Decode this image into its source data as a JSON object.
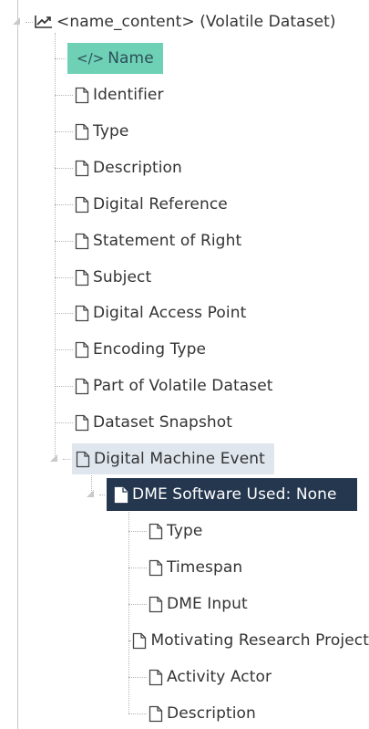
{
  "root": {
    "label": "<name_content> (Volatile Dataset)",
    "icon": "line-chart-icon"
  },
  "children": [
    {
      "label": "Name",
      "icon": "code-icon",
      "state": "highlighted"
    },
    {
      "label": "Identifier",
      "icon": "document-icon"
    },
    {
      "label": "Type",
      "icon": "document-icon"
    },
    {
      "label": "Description",
      "icon": "document-icon"
    },
    {
      "label": "Digital Reference",
      "icon": "document-icon"
    },
    {
      "label": "Statement of Right",
      "icon": "document-icon"
    },
    {
      "label": "Subject",
      "icon": "document-icon"
    },
    {
      "label": "Digital Access Point",
      "icon": "document-icon"
    },
    {
      "label": "Encoding Type",
      "icon": "document-icon"
    },
    {
      "label": "Part of Volatile Dataset",
      "icon": "document-icon"
    },
    {
      "label": "Dataset Snapshot",
      "icon": "document-icon"
    },
    {
      "label": "Digital Machine Event",
      "icon": "document-icon",
      "state": "hovered"
    }
  ],
  "dme": {
    "label": "DME Software Used: None",
    "icon": "document-icon",
    "state": "selected",
    "children": [
      {
        "label": "Type",
        "icon": "document-icon"
      },
      {
        "label": "Timespan",
        "icon": "document-icon"
      },
      {
        "label": "DME Input",
        "icon": "document-icon"
      },
      {
        "label": "Motivating Research Project",
        "icon": "document-icon"
      },
      {
        "label": "Activity Actor",
        "icon": "document-icon"
      },
      {
        "label": "Description",
        "icon": "document-icon"
      }
    ]
  },
  "colors": {
    "highlight": "#6ed1b5",
    "selected": "#24374e",
    "hover": "#dfe6ee"
  }
}
